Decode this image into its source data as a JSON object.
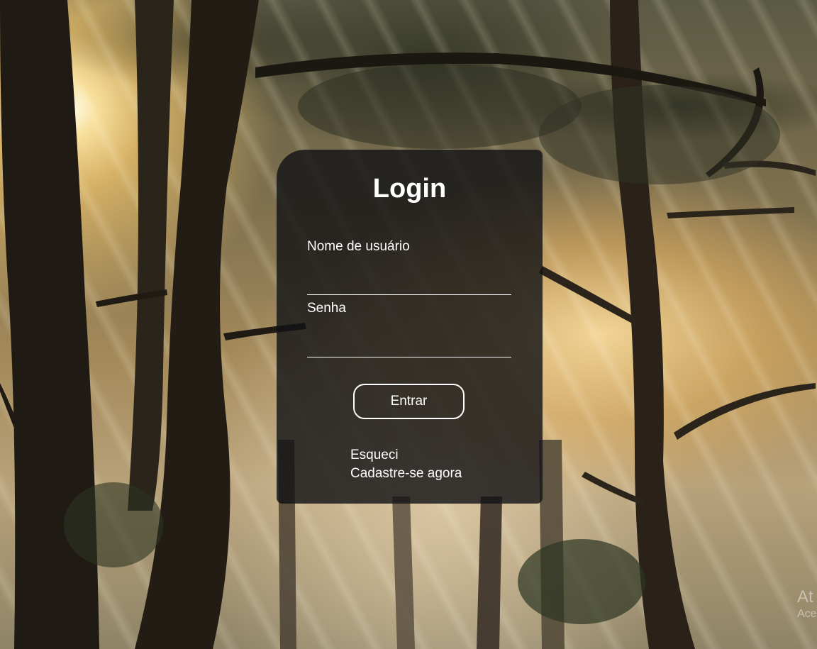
{
  "login": {
    "title": "Login",
    "username_label": "Nome de usuário",
    "username_value": "",
    "password_label": "Senha",
    "password_value": "",
    "submit_label": "Entrar",
    "forgot_link": "Esqueci",
    "signup_link": "Cadastre-se agora"
  },
  "watermark": {
    "line1": "At",
    "line2": "Ace"
  },
  "colors": {
    "card_background": "#141416",
    "text": "#ffffff"
  }
}
